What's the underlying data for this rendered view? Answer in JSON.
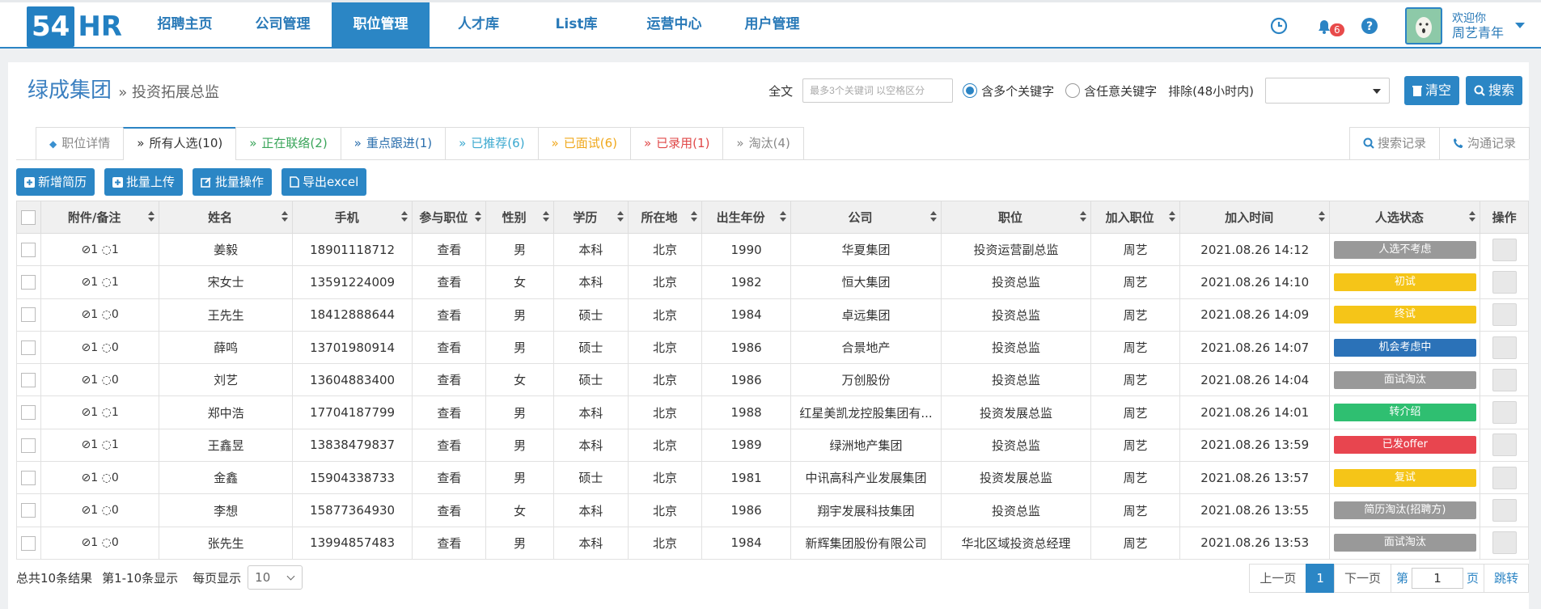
{
  "logo": {
    "badge": "54",
    "text": "HR"
  },
  "nav": [
    "招聘主页",
    "公司管理",
    "职位管理",
    "人才库",
    "List库",
    "运营中心",
    "用户管理"
  ],
  "nav_active": 2,
  "header": {
    "notif_count": "6",
    "welcome": "欢迎你",
    "username": "周艺青年"
  },
  "page": {
    "company": "绿成集团",
    "position": "» 投资拓展总监"
  },
  "filter": {
    "fulltext_label": "全文",
    "fulltext_placeholder": "最多3个关键词 以空格区分",
    "radio_all": "含多个关键字",
    "radio_any": "含任意关键字",
    "exclude_label": "排除(48小时内)",
    "clear": "清空",
    "search": "搜索"
  },
  "tabs": [
    {
      "label": "职位详情",
      "color": "#888"
    },
    {
      "label": "所有人选(10)",
      "color": "#333"
    },
    {
      "label": "正在联络(2)",
      "color": "#3aa55a"
    },
    {
      "label": "重点跟进(1)",
      "color": "#2b6fad"
    },
    {
      "label": "已推荐(6)",
      "color": "#3aa8cf"
    },
    {
      "label": "已面试(6)",
      "color": "#f0a81c"
    },
    {
      "label": "已录用(1)",
      "color": "#e04848"
    },
    {
      "label": "淘汰(4)",
      "color": "#888"
    }
  ],
  "tabs_right": {
    "history": "搜索记录",
    "contact": "沟通记录"
  },
  "actions": {
    "add": "新增简历",
    "upload": "批量上传",
    "batch": "批量操作",
    "export": "导出excel"
  },
  "columns": [
    "附件/备注",
    "姓名",
    "手机",
    "参与职位",
    "性别",
    "学历",
    "所在地",
    "出生年份",
    "公司",
    "职位",
    "加入职位",
    "加入时间",
    "人选状态",
    "操作"
  ],
  "rows": [
    {
      "att": "1",
      "note": "1",
      "name": "姜毅",
      "phone": "18901118712",
      "view": "查看",
      "sex": "男",
      "edu": "本科",
      "city": "北京",
      "year": "1990",
      "company": "华夏集团",
      "title": "投资运营副总监",
      "by": "周艺",
      "time": "2021.08.26 14:12",
      "status": "人选不考虑",
      "color": "#999999"
    },
    {
      "att": "1",
      "note": "1",
      "name": "宋女士",
      "phone": "13591224009",
      "view": "查看",
      "sex": "女",
      "edu": "本科",
      "city": "北京",
      "year": "1982",
      "company": "恒大集团",
      "title": "投资总监",
      "by": "周艺",
      "time": "2021.08.26 14:10",
      "status": "初试",
      "color": "#f5c518"
    },
    {
      "att": "1",
      "note": "0",
      "name": "王先生",
      "phone": "18412888644",
      "view": "查看",
      "sex": "男",
      "edu": "硕士",
      "city": "北京",
      "year": "1984",
      "company": "卓远集团",
      "title": "投资总监",
      "by": "周艺",
      "time": "2021.08.26 14:09",
      "status": "终试",
      "color": "#f5c518"
    },
    {
      "att": "1",
      "note": "0",
      "name": "薛鸣",
      "phone": "13701980914",
      "view": "查看",
      "sex": "男",
      "edu": "硕士",
      "city": "北京",
      "year": "1986",
      "company": "合景地产",
      "title": "投资总监",
      "by": "周艺",
      "time": "2021.08.26 14:07",
      "status": "机会考虑中",
      "color": "#2b72b8"
    },
    {
      "att": "1",
      "note": "0",
      "name": "刘艺",
      "phone": "13604883400",
      "view": "查看",
      "sex": "女",
      "edu": "硕士",
      "city": "北京",
      "year": "1986",
      "company": "万创股份",
      "title": "投资总监",
      "by": "周艺",
      "time": "2021.08.26 14:04",
      "status": "面试淘汰",
      "color": "#999999"
    },
    {
      "att": "1",
      "note": "1",
      "name": "郑中浩",
      "phone": "17704187799",
      "view": "查看",
      "sex": "男",
      "edu": "本科",
      "city": "北京",
      "year": "1988",
      "company": "红星美凯龙控股集团有...",
      "title": "投资发展总监",
      "by": "周艺",
      "time": "2021.08.26 14:01",
      "status": "转介绍",
      "color": "#2fbf71"
    },
    {
      "att": "1",
      "note": "1",
      "name": "王鑫昱",
      "phone": "13838479837",
      "view": "查看",
      "sex": "男",
      "edu": "本科",
      "city": "北京",
      "year": "1989",
      "company": "绿洲地产集团",
      "title": "投资总监",
      "by": "周艺",
      "time": "2021.08.26 13:59",
      "status": "已发offer",
      "color": "#e8454f"
    },
    {
      "att": "1",
      "note": "0",
      "name": "金鑫",
      "phone": "15904338733",
      "view": "查看",
      "sex": "男",
      "edu": "硕士",
      "city": "北京",
      "year": "1981",
      "company": "中讯高科产业发展集团",
      "title": "投资发展总监",
      "by": "周艺",
      "time": "2021.08.26 13:57",
      "status": "复试",
      "color": "#f5c518"
    },
    {
      "att": "1",
      "note": "0",
      "name": "李想",
      "phone": "15877364930",
      "view": "查看",
      "sex": "女",
      "edu": "本科",
      "city": "北京",
      "year": "1986",
      "company": "翔宇发展科技集团",
      "title": "投资总监",
      "by": "周艺",
      "time": "2021.08.26 13:55",
      "status": "简历淘汰(招聘方)",
      "color": "#999999"
    },
    {
      "att": "1",
      "note": "0",
      "name": "张先生",
      "phone": "13994857483",
      "view": "查看",
      "sex": "男",
      "edu": "本科",
      "city": "北京",
      "year": "1984",
      "company": "新辉集团股份有限公司",
      "title": "华北区域投资总经理",
      "by": "周艺",
      "time": "2021.08.26 13:53",
      "status": "面试淘汰",
      "color": "#999999"
    }
  ],
  "footer": {
    "total": "总共10条结果",
    "range": "第1-10条显示",
    "per_page_label": "每页显示",
    "per_page": "10",
    "prev": "上一页",
    "current": "1",
    "next": "下一页",
    "goto_prefix": "第",
    "goto_value": "1",
    "goto_suffix": "页",
    "jump": "跳转"
  }
}
